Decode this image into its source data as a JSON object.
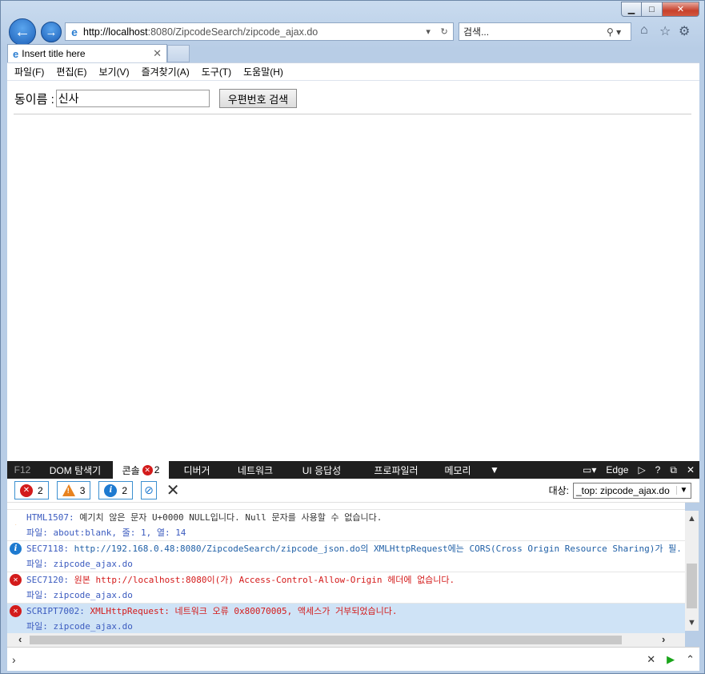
{
  "window": {
    "minimize": "▁",
    "maximize": "□",
    "close": "✕"
  },
  "nav": {
    "back_icon": "🡐",
    "forward_icon": "🡒",
    "url_host": "http://localhost",
    "url_rest": ":8080/ZipcodeSearch/zipcode_ajax.do",
    "search_placeholder": "검색...",
    "search_icon": "⚲ ▾"
  },
  "tab": {
    "title": "Insert title here",
    "close": "✕"
  },
  "menu": [
    "파일(F)",
    "편집(E)",
    "보기(V)",
    "즐겨찾기(A)",
    "도구(T)",
    "도움말(H)"
  ],
  "form": {
    "label": "동이름 :",
    "value": "신사",
    "button": "우편번호 검색"
  },
  "devtools": {
    "tabs": [
      "F12",
      "DOM 탐색기",
      "콘솔",
      "디버거",
      "네트워크",
      "UI 응답성",
      "프로파일러",
      "메모리"
    ],
    "console_error_count": "2",
    "emulation": "Edge",
    "filters": {
      "errors": "2",
      "warnings": "3",
      "info": "2"
    },
    "target_label": "대상:",
    "target_value": "_top: zipcode_ajax.do"
  },
  "console": {
    "rows": [
      {
        "type": "warn",
        "code": "HTML1507:",
        "text": " 예기치 않은 문자 U+0000 NULL입니다. Null 문자를 사용할 수 없습니다.",
        "file_label": "파일:",
        "file": " about:blank, 줄: 1, 열: 14"
      },
      {
        "type": "info",
        "code": "SEC7118:",
        "text": " http://192.168.0.48:8080/ZipcodeSearch/zipcode_json.do의 XMLHttpRequest에는 CORS(Cross Origin Resource Sharing)가 필.",
        "file_label": "파일:",
        "file": " zipcode_ajax.do"
      },
      {
        "type": "err",
        "code": "SEC7120:",
        "text": " 원본 http://localhost:8080이(가) Access-Control-Allow-Origin 헤더에 없습니다.",
        "file_label": "파일:",
        "file": " zipcode_ajax.do"
      },
      {
        "type": "err",
        "code": "SCRIPT7002:",
        "text": " XMLHttpRequest: 네트워크 오류 0x80070005, 액세스가 거부되었습니다.",
        "file_label": "파일:",
        "file": " zipcode_ajax.do"
      }
    ]
  }
}
